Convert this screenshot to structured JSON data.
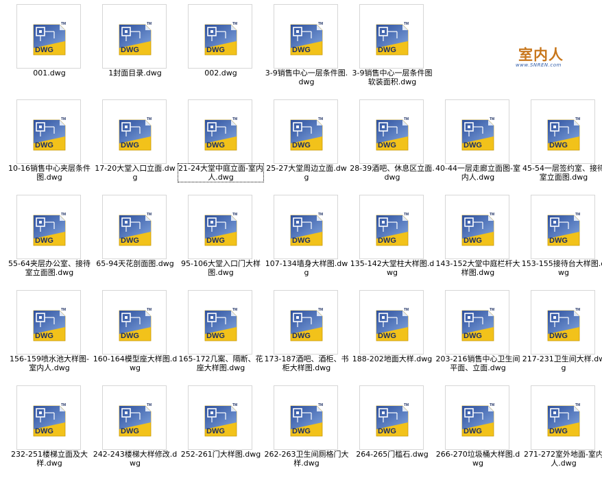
{
  "colors": {
    "caption_text": "#000000",
    "thumb_border": "#d6d6d6",
    "dwg_icon_yellow": "#f2c21a",
    "dwg_icon_blue": "#3b68b7",
    "logo_orange": "#c8771c",
    "logo_blue": "#2c5aa8"
  },
  "icon": {
    "name": "dwg-file-icon",
    "label": "DWG",
    "tm": "TM"
  },
  "logo": {
    "main": "室内人",
    "sub": "www.SNREN.com"
  },
  "selected_index": 7,
  "files": [
    "001.dwg",
    "1封面目录.dwg",
    "002.dwg",
    "3-9销售中心一层条件图.dwg",
    "3-9销售中心一层条件图软装面积.dwg",
    "10-16销售中心夹层条件图.dwg",
    "17-20大堂入口立面.dwg",
    "21-24大堂中庭立面-室内人.dwg",
    "25-27大堂周边立面.dwg",
    "28-39酒吧、休息区立面.dwg",
    "40-44一层走廊立面图-室内人.dwg",
    "45-54一层签约室、接待室立面图.dwg",
    "55-64夹层办公室、接待室立面图.dwg",
    "65-94天花剖面图.dwg",
    "95-106大堂入口门大样图.dwg",
    "107-134墙身大样图.dwg",
    "135-142大堂柱大样图.dwg",
    "143-152大堂中庭栏杆大样图.dwg",
    "153-155接待台大样图.dwg",
    "156-159喷水池大样图-室内人.dwg",
    "160-164模型座大样图.dwg",
    "165-172几案、隔断、花座大样图.dwg",
    "173-187酒吧、酒柜、书柜大样图.dwg",
    "188-202地面大样.dwg",
    "203-216销售中心卫生间平面、立面.dwg",
    "217-231卫生间大样.dwg",
    "232-251楼梯立面及大样.dwg",
    "242-243楼梯大样修改.dwg",
    "252-261门大样图.dwg",
    "262-263卫生间厕格门大样.dwg",
    "264-265门槛石.dwg",
    "266-270垃圾桶大样图.dwg",
    "271-272室外地面-室内人.dwg"
  ]
}
